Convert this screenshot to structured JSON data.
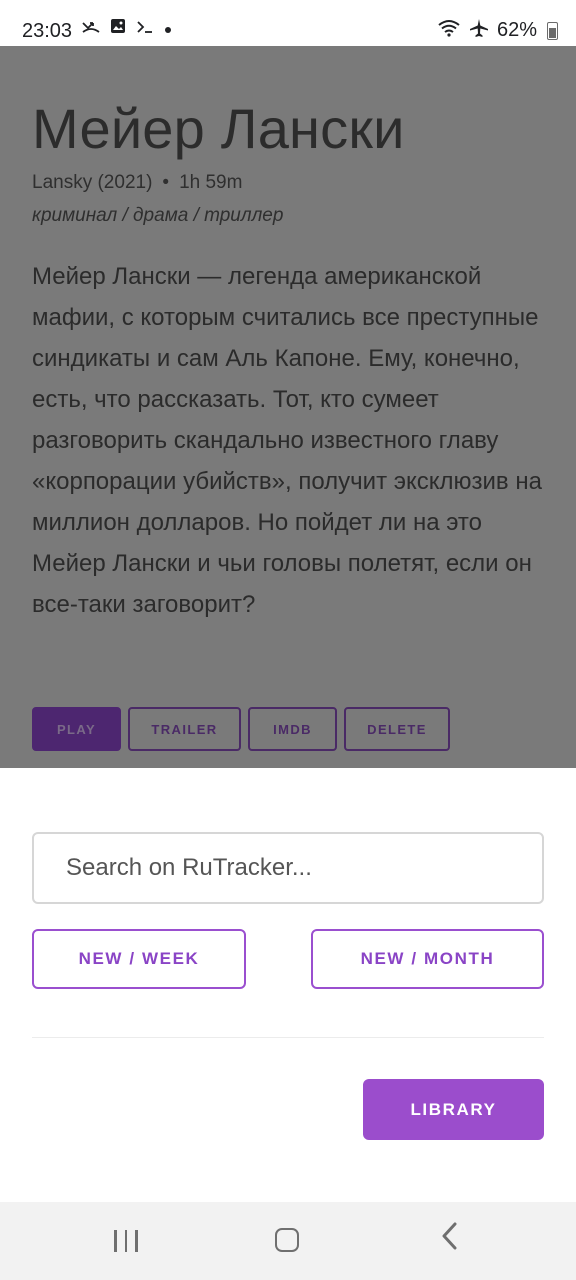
{
  "status_bar": {
    "time": "23:03",
    "battery_percent": "62%",
    "left_icons": [
      "missed-call-icon",
      "gallery-icon",
      "terminal-icon",
      "dot-icon"
    ],
    "right_icons": [
      "wifi-icon",
      "airplane-icon"
    ]
  },
  "movie": {
    "title": "Мейер Лански",
    "original_title_year": "Lansky (2021)",
    "separator": "•",
    "duration": "1h 59m",
    "genres": "криминал / драма / триллер",
    "description": "Мейер Лански — легенда американской мафии, с которым считались все преступные синдикаты и сам Аль Капоне. Ему, конечно, есть, что рассказать. Тот, кто сумеет разговорить скандально известного главу «корпорации убийств», получит эксклюзив на миллион долларов. Но пойдет ли на это Мейер Лански и чьи головы полетят, если он все-таки заговорит?",
    "actions": {
      "play": "PLAY",
      "trailer": "TRAILER",
      "imdb": "IMDB",
      "delete": "DELETE"
    }
  },
  "sheet": {
    "search_placeholder": "Search on RuTracker...",
    "new_week_label": "NEW / WEEK",
    "new_month_label": "NEW / MONTH",
    "library_label": "LIBRARY"
  },
  "colors": {
    "accent": "#9b4dcc",
    "scrim": "#7a7a7a"
  }
}
